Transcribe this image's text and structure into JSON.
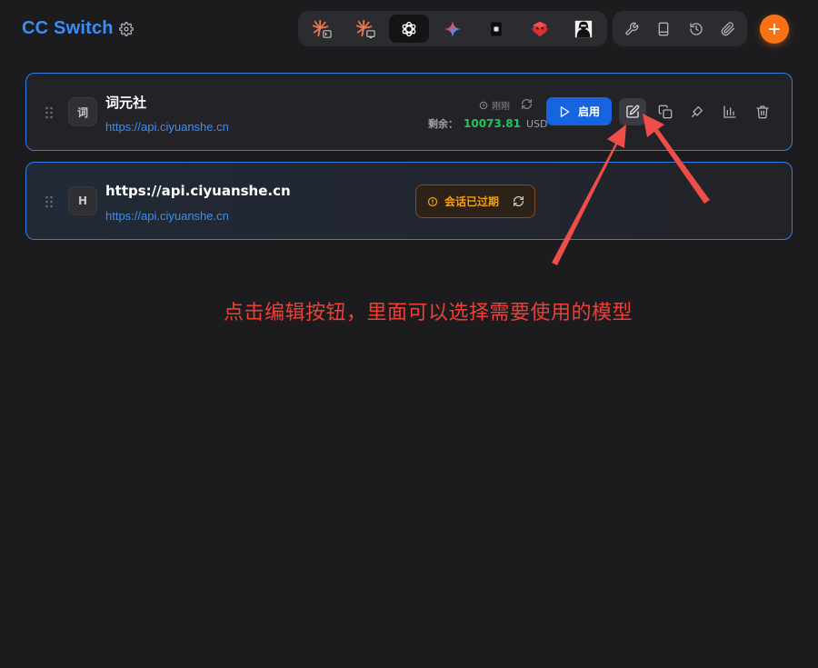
{
  "app": {
    "title": "CC Switch"
  },
  "header": {
    "apps": [
      {
        "name": "claude-code-icon",
        "color": "#e27b55"
      },
      {
        "name": "claude-desktop-icon",
        "color": "#e27b55"
      },
      {
        "name": "openai-icon",
        "color": "#ffffff",
        "active": true
      },
      {
        "name": "gemini-icon",
        "color": "#4a8cf7"
      },
      {
        "name": "terminal-app-icon",
        "color": "#e6e6e6"
      },
      {
        "name": "red-bug-icon",
        "color": "#e53935"
      },
      {
        "name": "portrait-icon",
        "color": "#ffffff"
      }
    ],
    "tools": [
      "wrench-icon",
      "book-icon",
      "history-icon",
      "paperclip-icon"
    ],
    "accent": "#f97316"
  },
  "providers": [
    {
      "name": "词元社",
      "avatar": "词",
      "url": "https://api.ciyuanshe.cn",
      "usage_time": "刚刚",
      "balance_label": "剩余：",
      "balance_value": "10073.81",
      "balance_unit": "USD",
      "enable_label": "启用"
    },
    {
      "name": "https://api.ciyuanshe.cn",
      "avatar": "H",
      "url": "https://api.ciyuanshe.cn",
      "status_text": "会话已过期"
    }
  ],
  "annotation": {
    "text": "点击编辑按钮，里面可以选择需要使用的模型",
    "color": "#ee3f36"
  },
  "colors": {
    "link": "#3b8ef5",
    "card_border": "#2f7fe6",
    "balance": "#22c55e",
    "warning": "#f59e0b",
    "primary_button": "#1664e0"
  }
}
